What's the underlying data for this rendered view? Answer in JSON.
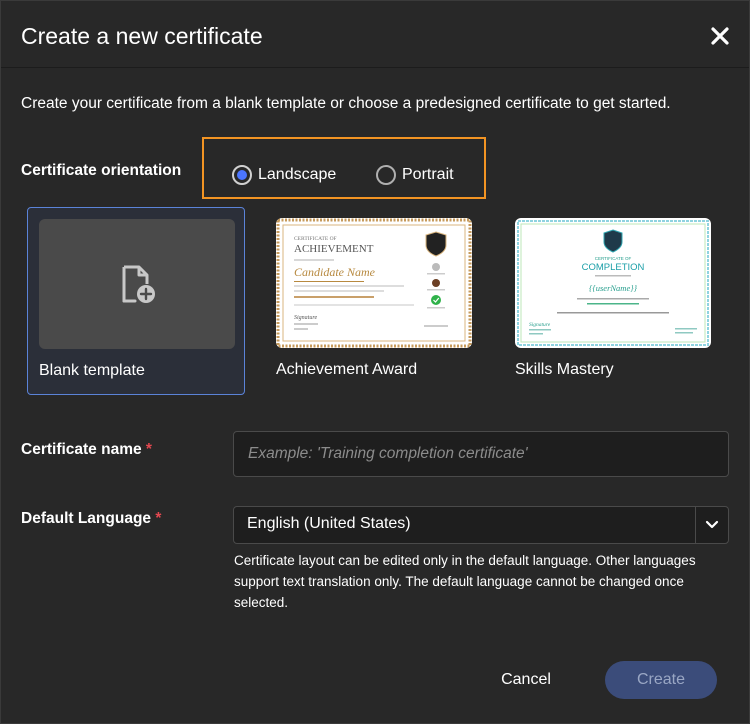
{
  "dialog": {
    "title": "Create a new certificate",
    "intro": "Create your certificate from a blank template or choose a predesigned certificate to get started."
  },
  "orientation": {
    "label": "Certificate orientation",
    "options": [
      {
        "label": "Landscape",
        "selected": true
      },
      {
        "label": "Portrait",
        "selected": false
      }
    ]
  },
  "templates": [
    {
      "label": "Blank template",
      "selected": true,
      "icon": "add-file-icon"
    },
    {
      "label": "Achievement Award",
      "selected": false,
      "preview": {
        "heading_small": "CERTIFICATE OF",
        "heading": "ACHIEVEMENT",
        "name": "Candidate Name",
        "signature": "Signature"
      }
    },
    {
      "label": "Skills Mastery",
      "selected": false,
      "preview": {
        "heading_small": "CERTIFICATE OF",
        "heading": "COMPLETION",
        "name": "{{userName}}",
        "signature": "Signature"
      }
    }
  ],
  "name_field": {
    "label": "Certificate name",
    "required_mark": "*",
    "placeholder": "Example: 'Training completion certificate'",
    "value": ""
  },
  "language": {
    "label": "Default Language",
    "required_mark": "*",
    "value": "English (United States)",
    "helper": "Certificate layout can be edited only in the default language. Other languages support text translation only. The default language cannot be changed once selected."
  },
  "actions": {
    "cancel": "Cancel",
    "create": "Create"
  },
  "colors": {
    "background": "#282828",
    "accent": "#4b75ff",
    "highlight_border": "#f29423",
    "required": "#e34850",
    "create_disabled": "#3b4c7a"
  }
}
